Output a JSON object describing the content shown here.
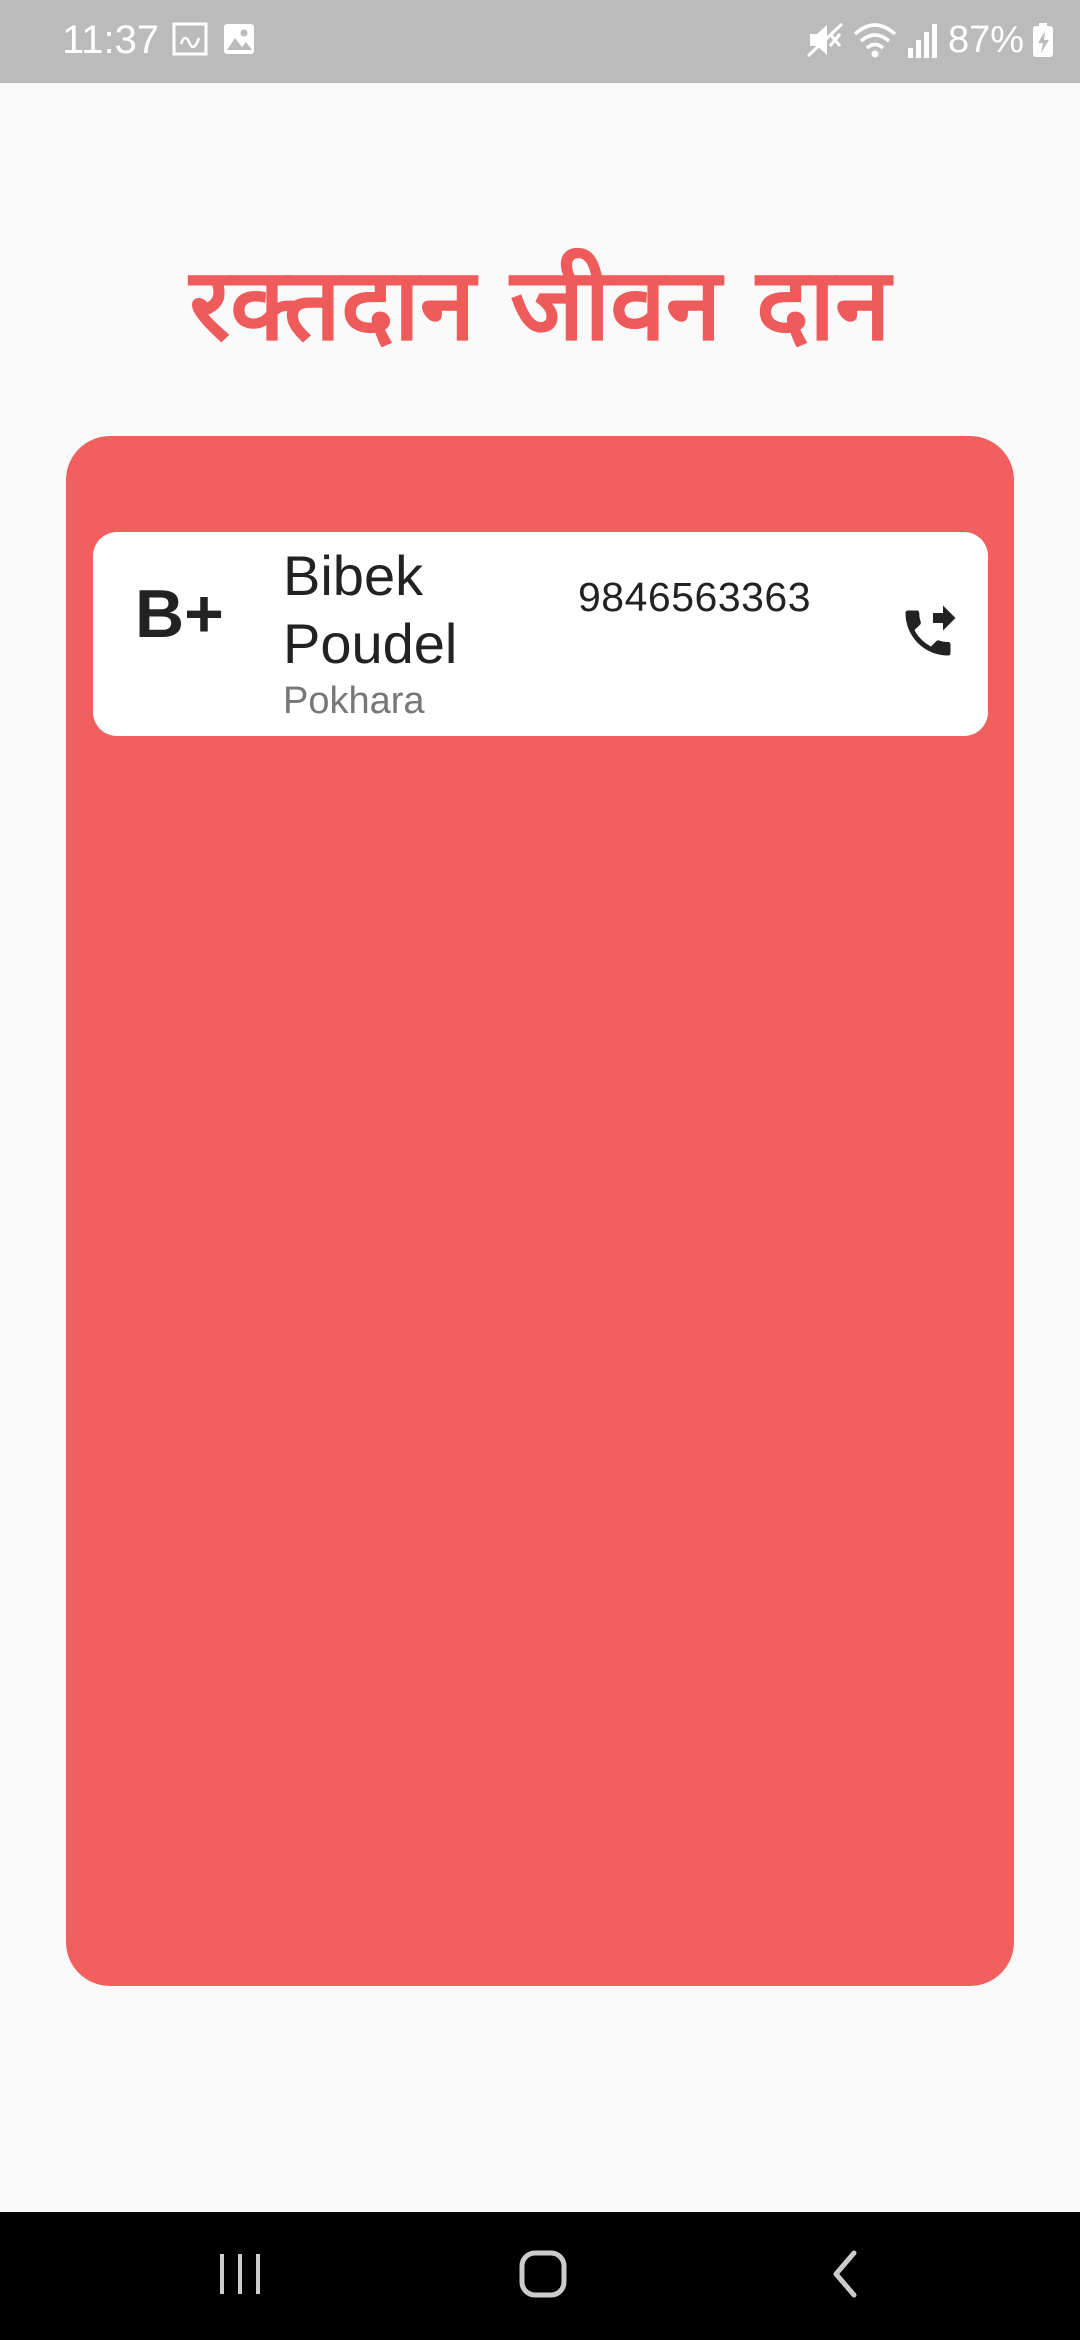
{
  "status_bar": {
    "time": "11:37",
    "battery": "87%",
    "icons": [
      "calendar-icon",
      "gallery-icon",
      "mute-icon",
      "wifi-icon",
      "signal-icon",
      "battery-charging-icon"
    ]
  },
  "header": {
    "title": "रक्तदान जीवन दान"
  },
  "donors": [
    {
      "blood_group": "B+",
      "name": "Bibek Poudel",
      "city": "Pokhara",
      "phone": "9846563363",
      "action_icon": "phone-forward-icon"
    }
  ],
  "navigation": {
    "buttons": [
      "recents-icon",
      "home-icon",
      "back-icon"
    ]
  },
  "colors": {
    "accent": "#ef5a5a",
    "panel": "#f25f5f",
    "status_bar": "#bbbbbb",
    "nav_bar": "#000000",
    "card": "#ffffff"
  }
}
